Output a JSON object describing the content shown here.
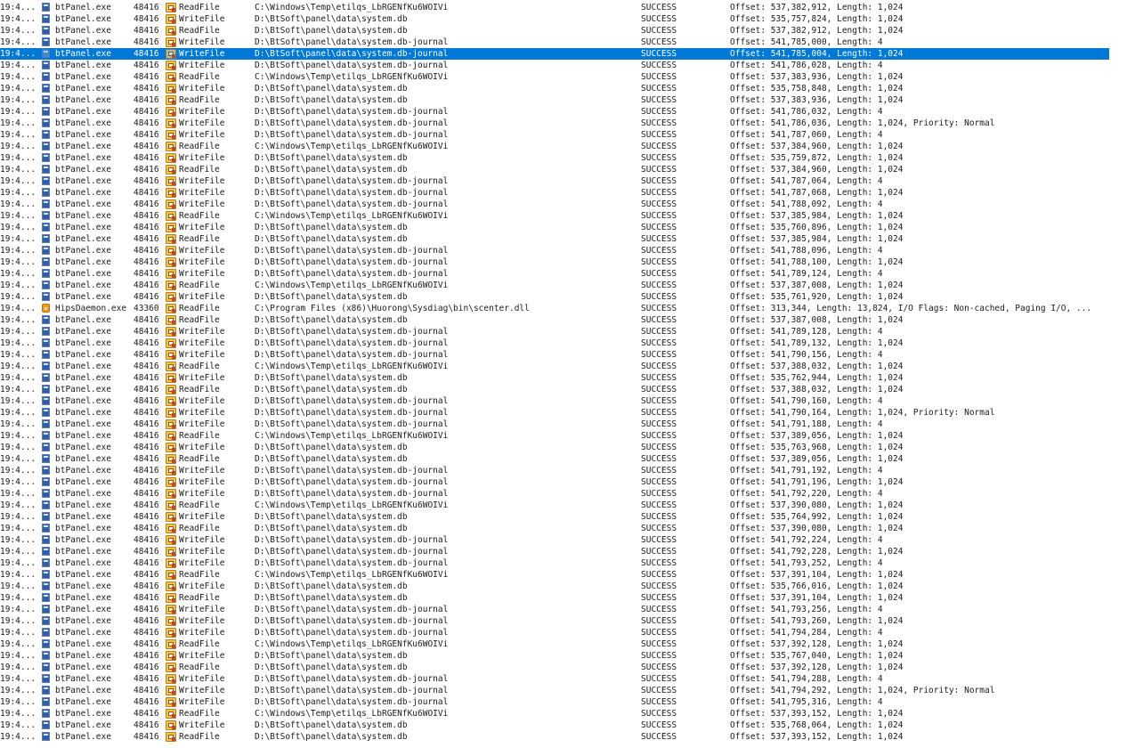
{
  "colors": {
    "selection_background": "#0078d7",
    "selection_text": "#ffffff",
    "text": "#1a1a1a"
  },
  "icons": {
    "btpanel_process": "process-icon",
    "hips_process": "hips-daemon-icon",
    "file_operation": "file-system-operation-icon"
  },
  "events": [
    {
      "time": "19:4...",
      "process": "btPanel.exe",
      "pid": "48416",
      "operation": "ReadFile",
      "path": "C:\\Windows\\Temp\\etilqs_LbRGENfKu6WOIVi",
      "result": "SUCCESS",
      "detail": "Offset: 537,382,912, Length: 1,024"
    },
    {
      "time": "19:4...",
      "process": "btPanel.exe",
      "pid": "48416",
      "operation": "WriteFile",
      "path": "D:\\BtSoft\\panel\\data\\system.db",
      "result": "SUCCESS",
      "detail": "Offset: 535,757,824, Length: 1,024"
    },
    {
      "time": "19:4...",
      "process": "btPanel.exe",
      "pid": "48416",
      "operation": "ReadFile",
      "path": "D:\\BtSoft\\panel\\data\\system.db",
      "result": "SUCCESS",
      "detail": "Offset: 537,382,912, Length: 1,024"
    },
    {
      "time": "19:4...",
      "process": "btPanel.exe",
      "pid": "48416",
      "operation": "WriteFile",
      "path": "D:\\BtSoft\\panel\\data\\system.db-journal",
      "result": "SUCCESS",
      "detail": "Offset: 541,785,000, Length: 4"
    },
    {
      "time": "19:4...",
      "process": "btPanel.exe",
      "pid": "48416",
      "operation": "WriteFile",
      "path": "D:\\BtSoft\\panel\\data\\system.db-journal",
      "result": "SUCCESS",
      "detail": "Offset: 541,785,004, Length: 1,024",
      "selected": true
    },
    {
      "time": "19:4...",
      "process": "btPanel.exe",
      "pid": "48416",
      "operation": "WriteFile",
      "path": "D:\\BtSoft\\panel\\data\\system.db-journal",
      "result": "SUCCESS",
      "detail": "Offset: 541,786,028, Length: 4"
    },
    {
      "time": "19:4...",
      "process": "btPanel.exe",
      "pid": "48416",
      "operation": "ReadFile",
      "path": "C:\\Windows\\Temp\\etilqs_LbRGENfKu6WOIVi",
      "result": "SUCCESS",
      "detail": "Offset: 537,383,936, Length: 1,024"
    },
    {
      "time": "19:4...",
      "process": "btPanel.exe",
      "pid": "48416",
      "operation": "WriteFile",
      "path": "D:\\BtSoft\\panel\\data\\system.db",
      "result": "SUCCESS",
      "detail": "Offset: 535,758,848, Length: 1,024"
    },
    {
      "time": "19:4...",
      "process": "btPanel.exe",
      "pid": "48416",
      "operation": "ReadFile",
      "path": "D:\\BtSoft\\panel\\data\\system.db",
      "result": "SUCCESS",
      "detail": "Offset: 537,383,936, Length: 1,024"
    },
    {
      "time": "19:4...",
      "process": "btPanel.exe",
      "pid": "48416",
      "operation": "WriteFile",
      "path": "D:\\BtSoft\\panel\\data\\system.db-journal",
      "result": "SUCCESS",
      "detail": "Offset: 541,786,032, Length: 4"
    },
    {
      "time": "19:4...",
      "process": "btPanel.exe",
      "pid": "48416",
      "operation": "WriteFile",
      "path": "D:\\BtSoft\\panel\\data\\system.db-journal",
      "result": "SUCCESS",
      "detail": "Offset: 541,786,036, Length: 1,024, Priority: Normal"
    },
    {
      "time": "19:4...",
      "process": "btPanel.exe",
      "pid": "48416",
      "operation": "WriteFile",
      "path": "D:\\BtSoft\\panel\\data\\system.db-journal",
      "result": "SUCCESS",
      "detail": "Offset: 541,787,060, Length: 4"
    },
    {
      "time": "19:4...",
      "process": "btPanel.exe",
      "pid": "48416",
      "operation": "ReadFile",
      "path": "C:\\Windows\\Temp\\etilqs_LbRGENfKu6WOIVi",
      "result": "SUCCESS",
      "detail": "Offset: 537,384,960, Length: 1,024"
    },
    {
      "time": "19:4...",
      "process": "btPanel.exe",
      "pid": "48416",
      "operation": "WriteFile",
      "path": "D:\\BtSoft\\panel\\data\\system.db",
      "result": "SUCCESS",
      "detail": "Offset: 535,759,872, Length: 1,024"
    },
    {
      "time": "19:4...",
      "process": "btPanel.exe",
      "pid": "48416",
      "operation": "ReadFile",
      "path": "D:\\BtSoft\\panel\\data\\system.db",
      "result": "SUCCESS",
      "detail": "Offset: 537,384,960, Length: 1,024"
    },
    {
      "time": "19:4...",
      "process": "btPanel.exe",
      "pid": "48416",
      "operation": "WriteFile",
      "path": "D:\\BtSoft\\panel\\data\\system.db-journal",
      "result": "SUCCESS",
      "detail": "Offset: 541,787,064, Length: 4"
    },
    {
      "time": "19:4...",
      "process": "btPanel.exe",
      "pid": "48416",
      "operation": "WriteFile",
      "path": "D:\\BtSoft\\panel\\data\\system.db-journal",
      "result": "SUCCESS",
      "detail": "Offset: 541,787,068, Length: 1,024"
    },
    {
      "time": "19:4...",
      "process": "btPanel.exe",
      "pid": "48416",
      "operation": "WriteFile",
      "path": "D:\\BtSoft\\panel\\data\\system.db-journal",
      "result": "SUCCESS",
      "detail": "Offset: 541,788,092, Length: 4"
    },
    {
      "time": "19:4...",
      "process": "btPanel.exe",
      "pid": "48416",
      "operation": "ReadFile",
      "path": "C:\\Windows\\Temp\\etilqs_LbRGENfKu6WOIVi",
      "result": "SUCCESS",
      "detail": "Offset: 537,385,984, Length: 1,024"
    },
    {
      "time": "19:4...",
      "process": "btPanel.exe",
      "pid": "48416",
      "operation": "WriteFile",
      "path": "D:\\BtSoft\\panel\\data\\system.db",
      "result": "SUCCESS",
      "detail": "Offset: 535,760,896, Length: 1,024"
    },
    {
      "time": "19:4...",
      "process": "btPanel.exe",
      "pid": "48416",
      "operation": "ReadFile",
      "path": "D:\\BtSoft\\panel\\data\\system.db",
      "result": "SUCCESS",
      "detail": "Offset: 537,385,984, Length: 1,024"
    },
    {
      "time": "19:4...",
      "process": "btPanel.exe",
      "pid": "48416",
      "operation": "WriteFile",
      "path": "D:\\BtSoft\\panel\\data\\system.db-journal",
      "result": "SUCCESS",
      "detail": "Offset: 541,788,096, Length: 4"
    },
    {
      "time": "19:4...",
      "process": "btPanel.exe",
      "pid": "48416",
      "operation": "WriteFile",
      "path": "D:\\BtSoft\\panel\\data\\system.db-journal",
      "result": "SUCCESS",
      "detail": "Offset: 541,788,100, Length: 1,024"
    },
    {
      "time": "19:4...",
      "process": "btPanel.exe",
      "pid": "48416",
      "operation": "WriteFile",
      "path": "D:\\BtSoft\\panel\\data\\system.db-journal",
      "result": "SUCCESS",
      "detail": "Offset: 541,789,124, Length: 4"
    },
    {
      "time": "19:4...",
      "process": "btPanel.exe",
      "pid": "48416",
      "operation": "ReadFile",
      "path": "C:\\Windows\\Temp\\etilqs_LbRGENfKu6WOIVi",
      "result": "SUCCESS",
      "detail": "Offset: 537,387,008, Length: 1,024"
    },
    {
      "time": "19:4...",
      "process": "btPanel.exe",
      "pid": "48416",
      "operation": "WriteFile",
      "path": "D:\\BtSoft\\panel\\data\\system.db",
      "result": "SUCCESS",
      "detail": "Offset: 535,761,920, Length: 1,024"
    },
    {
      "time": "19:4...",
      "process": "HipsDaemon.exe",
      "pid": "43360",
      "operation": "ReadFile",
      "path": "C:\\Program Files (x86)\\Huorong\\Sysdiag\\bin\\scenter.dll",
      "result": "SUCCESS",
      "detail": "Offset: 313,344, Length: 13,824, I/O Flags: Non-cached, Paging I/O, ...",
      "hips": true
    },
    {
      "time": "19:4...",
      "process": "btPanel.exe",
      "pid": "48416",
      "operation": "ReadFile",
      "path": "D:\\BtSoft\\panel\\data\\system.db",
      "result": "SUCCESS",
      "detail": "Offset: 537,387,008, Length: 1,024"
    },
    {
      "time": "19:4...",
      "process": "btPanel.exe",
      "pid": "48416",
      "operation": "WriteFile",
      "path": "D:\\BtSoft\\panel\\data\\system.db-journal",
      "result": "SUCCESS",
      "detail": "Offset: 541,789,128, Length: 4"
    },
    {
      "time": "19:4...",
      "process": "btPanel.exe",
      "pid": "48416",
      "operation": "WriteFile",
      "path": "D:\\BtSoft\\panel\\data\\system.db-journal",
      "result": "SUCCESS",
      "detail": "Offset: 541,789,132, Length: 1,024"
    },
    {
      "time": "19:4...",
      "process": "btPanel.exe",
      "pid": "48416",
      "operation": "WriteFile",
      "path": "D:\\BtSoft\\panel\\data\\system.db-journal",
      "result": "SUCCESS",
      "detail": "Offset: 541,790,156, Length: 4"
    },
    {
      "time": "19:4...",
      "process": "btPanel.exe",
      "pid": "48416",
      "operation": "ReadFile",
      "path": "C:\\Windows\\Temp\\etilqs_LbRGENfKu6WOIVi",
      "result": "SUCCESS",
      "detail": "Offset: 537,388,032, Length: 1,024"
    },
    {
      "time": "19:4...",
      "process": "btPanel.exe",
      "pid": "48416",
      "operation": "WriteFile",
      "path": "D:\\BtSoft\\panel\\data\\system.db",
      "result": "SUCCESS",
      "detail": "Offset: 535,762,944, Length: 1,024"
    },
    {
      "time": "19:4...",
      "process": "btPanel.exe",
      "pid": "48416",
      "operation": "ReadFile",
      "path": "D:\\BtSoft\\panel\\data\\system.db",
      "result": "SUCCESS",
      "detail": "Offset: 537,388,032, Length: 1,024"
    },
    {
      "time": "19:4...",
      "process": "btPanel.exe",
      "pid": "48416",
      "operation": "WriteFile",
      "path": "D:\\BtSoft\\panel\\data\\system.db-journal",
      "result": "SUCCESS",
      "detail": "Offset: 541,790,160, Length: 4"
    },
    {
      "time": "19:4...",
      "process": "btPanel.exe",
      "pid": "48416",
      "operation": "WriteFile",
      "path": "D:\\BtSoft\\panel\\data\\system.db-journal",
      "result": "SUCCESS",
      "detail": "Offset: 541,790,164, Length: 1,024, Priority: Normal"
    },
    {
      "time": "19:4...",
      "process": "btPanel.exe",
      "pid": "48416",
      "operation": "WriteFile",
      "path": "D:\\BtSoft\\panel\\data\\system.db-journal",
      "result": "SUCCESS",
      "detail": "Offset: 541,791,188, Length: 4"
    },
    {
      "time": "19:4...",
      "process": "btPanel.exe",
      "pid": "48416",
      "operation": "ReadFile",
      "path": "C:\\Windows\\Temp\\etilqs_LbRGENfKu6WOIVi",
      "result": "SUCCESS",
      "detail": "Offset: 537,389,056, Length: 1,024"
    },
    {
      "time": "19:4...",
      "process": "btPanel.exe",
      "pid": "48416",
      "operation": "WriteFile",
      "path": "D:\\BtSoft\\panel\\data\\system.db",
      "result": "SUCCESS",
      "detail": "Offset: 535,763,968, Length: 1,024"
    },
    {
      "time": "19:4...",
      "process": "btPanel.exe",
      "pid": "48416",
      "operation": "ReadFile",
      "path": "D:\\BtSoft\\panel\\data\\system.db",
      "result": "SUCCESS",
      "detail": "Offset: 537,389,056, Length: 1,024"
    },
    {
      "time": "19:4...",
      "process": "btPanel.exe",
      "pid": "48416",
      "operation": "WriteFile",
      "path": "D:\\BtSoft\\panel\\data\\system.db-journal",
      "result": "SUCCESS",
      "detail": "Offset: 541,791,192, Length: 4"
    },
    {
      "time": "19:4...",
      "process": "btPanel.exe",
      "pid": "48416",
      "operation": "WriteFile",
      "path": "D:\\BtSoft\\panel\\data\\system.db-journal",
      "result": "SUCCESS",
      "detail": "Offset: 541,791,196, Length: 1,024"
    },
    {
      "time": "19:4...",
      "process": "btPanel.exe",
      "pid": "48416",
      "operation": "WriteFile",
      "path": "D:\\BtSoft\\panel\\data\\system.db-journal",
      "result": "SUCCESS",
      "detail": "Offset: 541,792,220, Length: 4"
    },
    {
      "time": "19:4...",
      "process": "btPanel.exe",
      "pid": "48416",
      "operation": "ReadFile",
      "path": "C:\\Windows\\Temp\\etilqs_LbRGENfKu6WOIVi",
      "result": "SUCCESS",
      "detail": "Offset: 537,390,080, Length: 1,024"
    },
    {
      "time": "19:4...",
      "process": "btPanel.exe",
      "pid": "48416",
      "operation": "WriteFile",
      "path": "D:\\BtSoft\\panel\\data\\system.db",
      "result": "SUCCESS",
      "detail": "Offset: 535,764,992, Length: 1,024"
    },
    {
      "time": "19:4...",
      "process": "btPanel.exe",
      "pid": "48416",
      "operation": "ReadFile",
      "path": "D:\\BtSoft\\panel\\data\\system.db",
      "result": "SUCCESS",
      "detail": "Offset: 537,390,080, Length: 1,024"
    },
    {
      "time": "19:4...",
      "process": "btPanel.exe",
      "pid": "48416",
      "operation": "WriteFile",
      "path": "D:\\BtSoft\\panel\\data\\system.db-journal",
      "result": "SUCCESS",
      "detail": "Offset: 541,792,224, Length: 4"
    },
    {
      "time": "19:4...",
      "process": "btPanel.exe",
      "pid": "48416",
      "operation": "WriteFile",
      "path": "D:\\BtSoft\\panel\\data\\system.db-journal",
      "result": "SUCCESS",
      "detail": "Offset: 541,792,228, Length: 1,024"
    },
    {
      "time": "19:4...",
      "process": "btPanel.exe",
      "pid": "48416",
      "operation": "WriteFile",
      "path": "D:\\BtSoft\\panel\\data\\system.db-journal",
      "result": "SUCCESS",
      "detail": "Offset: 541,793,252, Length: 4"
    },
    {
      "time": "19:4...",
      "process": "btPanel.exe",
      "pid": "48416",
      "operation": "ReadFile",
      "path": "C:\\Windows\\Temp\\etilqs_LbRGENfKu6WOIVi",
      "result": "SUCCESS",
      "detail": "Offset: 537,391,104, Length: 1,024"
    },
    {
      "time": "19:4...",
      "process": "btPanel.exe",
      "pid": "48416",
      "operation": "WriteFile",
      "path": "D:\\BtSoft\\panel\\data\\system.db",
      "result": "SUCCESS",
      "detail": "Offset: 535,766,016, Length: 1,024"
    },
    {
      "time": "19:4...",
      "process": "btPanel.exe",
      "pid": "48416",
      "operation": "ReadFile",
      "path": "D:\\BtSoft\\panel\\data\\system.db",
      "result": "SUCCESS",
      "detail": "Offset: 537,391,104, Length: 1,024"
    },
    {
      "time": "19:4...",
      "process": "btPanel.exe",
      "pid": "48416",
      "operation": "WriteFile",
      "path": "D:\\BtSoft\\panel\\data\\system.db-journal",
      "result": "SUCCESS",
      "detail": "Offset: 541,793,256, Length: 4"
    },
    {
      "time": "19:4...",
      "process": "btPanel.exe",
      "pid": "48416",
      "operation": "WriteFile",
      "path": "D:\\BtSoft\\panel\\data\\system.db-journal",
      "result": "SUCCESS",
      "detail": "Offset: 541,793,260, Length: 1,024"
    },
    {
      "time": "19:4...",
      "process": "btPanel.exe",
      "pid": "48416",
      "operation": "WriteFile",
      "path": "D:\\BtSoft\\panel\\data\\system.db-journal",
      "result": "SUCCESS",
      "detail": "Offset: 541,794,284, Length: 4"
    },
    {
      "time": "19:4...",
      "process": "btPanel.exe",
      "pid": "48416",
      "operation": "ReadFile",
      "path": "C:\\Windows\\Temp\\etilqs_LbRGENfKu6WOIVi",
      "result": "SUCCESS",
      "detail": "Offset: 537,392,128, Length: 1,024"
    },
    {
      "time": "19:4...",
      "process": "btPanel.exe",
      "pid": "48416",
      "operation": "WriteFile",
      "path": "D:\\BtSoft\\panel\\data\\system.db",
      "result": "SUCCESS",
      "detail": "Offset: 535,767,040, Length: 1,024"
    },
    {
      "time": "19:4...",
      "process": "btPanel.exe",
      "pid": "48416",
      "operation": "ReadFile",
      "path": "D:\\BtSoft\\panel\\data\\system.db",
      "result": "SUCCESS",
      "detail": "Offset: 537,392,128, Length: 1,024"
    },
    {
      "time": "19:4...",
      "process": "btPanel.exe",
      "pid": "48416",
      "operation": "WriteFile",
      "path": "D:\\BtSoft\\panel\\data\\system.db-journal",
      "result": "SUCCESS",
      "detail": "Offset: 541,794,288, Length: 4"
    },
    {
      "time": "19:4...",
      "process": "btPanel.exe",
      "pid": "48416",
      "operation": "WriteFile",
      "path": "D:\\BtSoft\\panel\\data\\system.db-journal",
      "result": "SUCCESS",
      "detail": "Offset: 541,794,292, Length: 1,024, Priority: Normal"
    },
    {
      "time": "19:4...",
      "process": "btPanel.exe",
      "pid": "48416",
      "operation": "WriteFile",
      "path": "D:\\BtSoft\\panel\\data\\system.db-journal",
      "result": "SUCCESS",
      "detail": "Offset: 541,795,316, Length: 4"
    },
    {
      "time": "19:4...",
      "process": "btPanel.exe",
      "pid": "48416",
      "operation": "ReadFile",
      "path": "C:\\Windows\\Temp\\etilqs_LbRGENfKu6WOIVi",
      "result": "SUCCESS",
      "detail": "Offset: 537,393,152, Length: 1,024"
    },
    {
      "time": "19:4...",
      "process": "btPanel.exe",
      "pid": "48416",
      "operation": "WriteFile",
      "path": "D:\\BtSoft\\panel\\data\\system.db",
      "result": "SUCCESS",
      "detail": "Offset: 535,768,064, Length: 1,024"
    },
    {
      "time": "19:4...",
      "process": "btPanel.exe",
      "pid": "48416",
      "operation": "ReadFile",
      "path": "D:\\BtSoft\\panel\\data\\system.db",
      "result": "SUCCESS",
      "detail": "Offset: 537,393,152, Length: 1,024"
    }
  ]
}
